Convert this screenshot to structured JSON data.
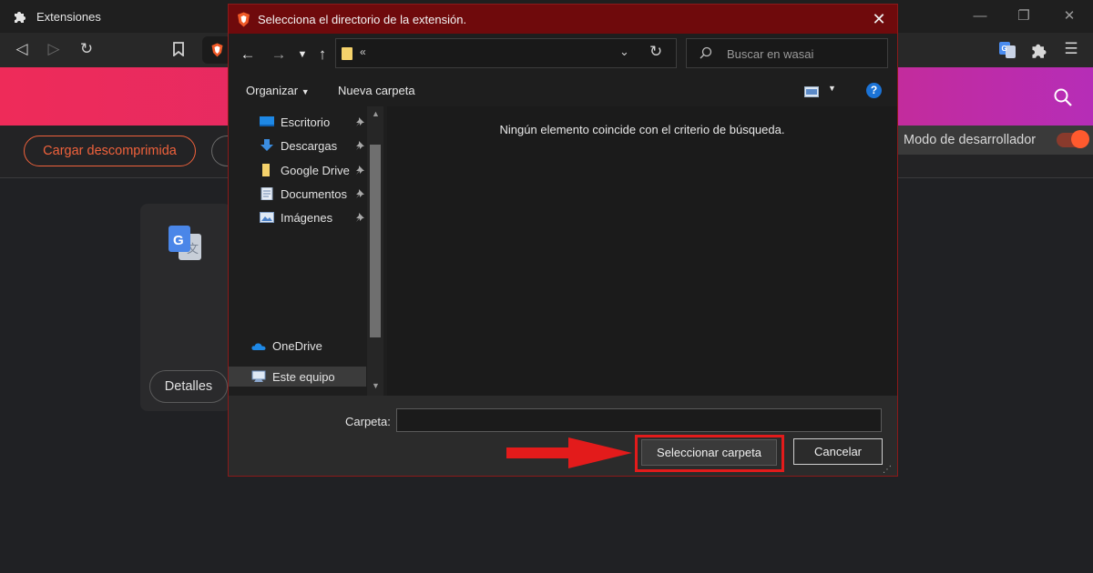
{
  "window": {
    "tab_title": "Extensiones"
  },
  "toolbar": {
    "back_icon": "back-icon",
    "forward_icon": "forward-icon",
    "reload_icon": "reload-icon",
    "bookmark_icon": "bookmark-icon"
  },
  "extensions_page": {
    "load_unpacked_label": "Cargar descomprimida",
    "developer_mode_label": "Modo de desarrollador",
    "developer_mode_on": true,
    "details_label": "Detalles"
  },
  "dialog": {
    "title": "Selecciona el directorio de la extensión.",
    "address_chevron": "«",
    "search_placeholder": "Buscar en wasai",
    "organize_label": "Organizar",
    "new_folder_label": "Nueva carpeta",
    "nav_items": [
      {
        "label": "Escritorio",
        "icon": "desktop-icon",
        "pinned": true
      },
      {
        "label": "Descargas",
        "icon": "downloads-icon",
        "pinned": true
      },
      {
        "label": "Google Drive",
        "icon": "folder-icon",
        "pinned": true
      },
      {
        "label": "Documentos",
        "icon": "documents-icon",
        "pinned": true
      },
      {
        "label": "Imágenes",
        "icon": "pictures-icon",
        "pinned": true
      }
    ],
    "onedrive_label": "OneDrive",
    "this_pc_label": "Este equipo",
    "empty_message": "Ningún elemento coincide con el criterio de búsqueda.",
    "folder_label": "Carpeta:",
    "folder_value": "",
    "select_folder_label": "Seleccionar carpeta",
    "cancel_label": "Cancelar"
  },
  "colors": {
    "accent": "#f0623c",
    "dialog_title_bg": "#6f0a0c",
    "highlight": "#e31b1b"
  }
}
